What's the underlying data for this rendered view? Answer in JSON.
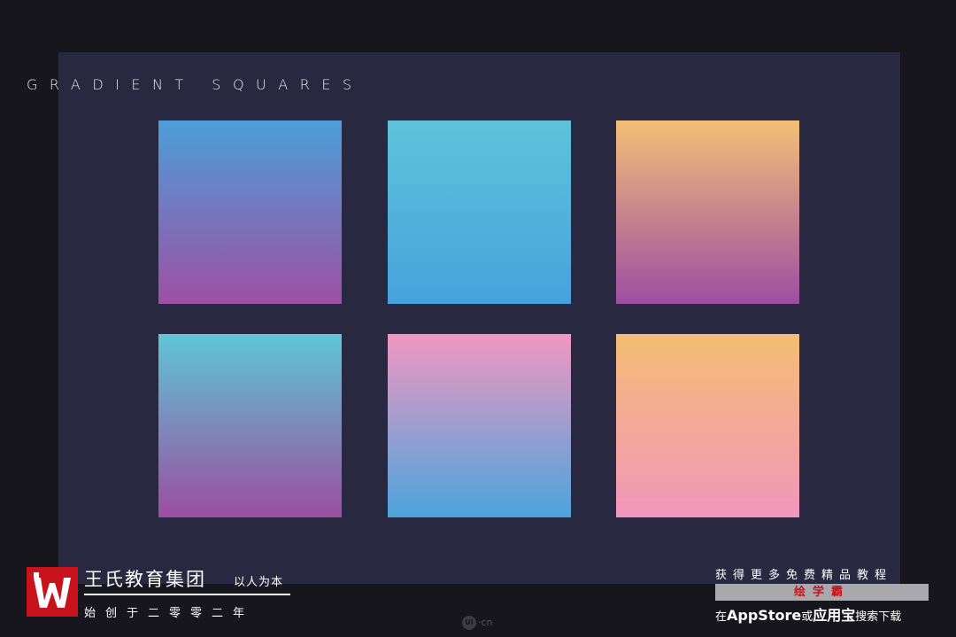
{
  "title": "GRADIENT SQUARES",
  "squares": [
    {
      "name": "gradient-square-1",
      "colors": [
        "#4d9ed9",
        "#9d50a3"
      ]
    },
    {
      "name": "gradient-square-2",
      "colors": [
        "#5ec3da",
        "#48a2dc"
      ]
    },
    {
      "name": "gradient-square-3",
      "colors": [
        "#f3bf77",
        "#9e4da2"
      ]
    },
    {
      "name": "gradient-square-4",
      "colors": [
        "#5fc6d7",
        "#9a4ea0"
      ]
    },
    {
      "name": "gradient-square-5",
      "colors": [
        "#f197c1",
        "#4ca4dc"
      ]
    },
    {
      "name": "gradient-square-6",
      "colors": [
        "#f4bd73",
        "#f296bd"
      ]
    }
  ],
  "footer": {
    "brand_name": "王氏教育集团",
    "brand_motto": "以人为本",
    "brand_since": "始创于二零零二年",
    "watermark": "·cn",
    "watermark_badge": "UI",
    "promo_line1": "获得更多免费精品教程",
    "promo_highlight": "绘学霸",
    "promo_line3_pre": "在",
    "promo_appstore": "AppStore",
    "promo_or": "或",
    "promo_yyb": "应用宝",
    "promo_line3_post": "搜索下载"
  },
  "colors": {
    "background": "#17161c",
    "canvas": "#282841",
    "logo_red": "#c8121c"
  }
}
